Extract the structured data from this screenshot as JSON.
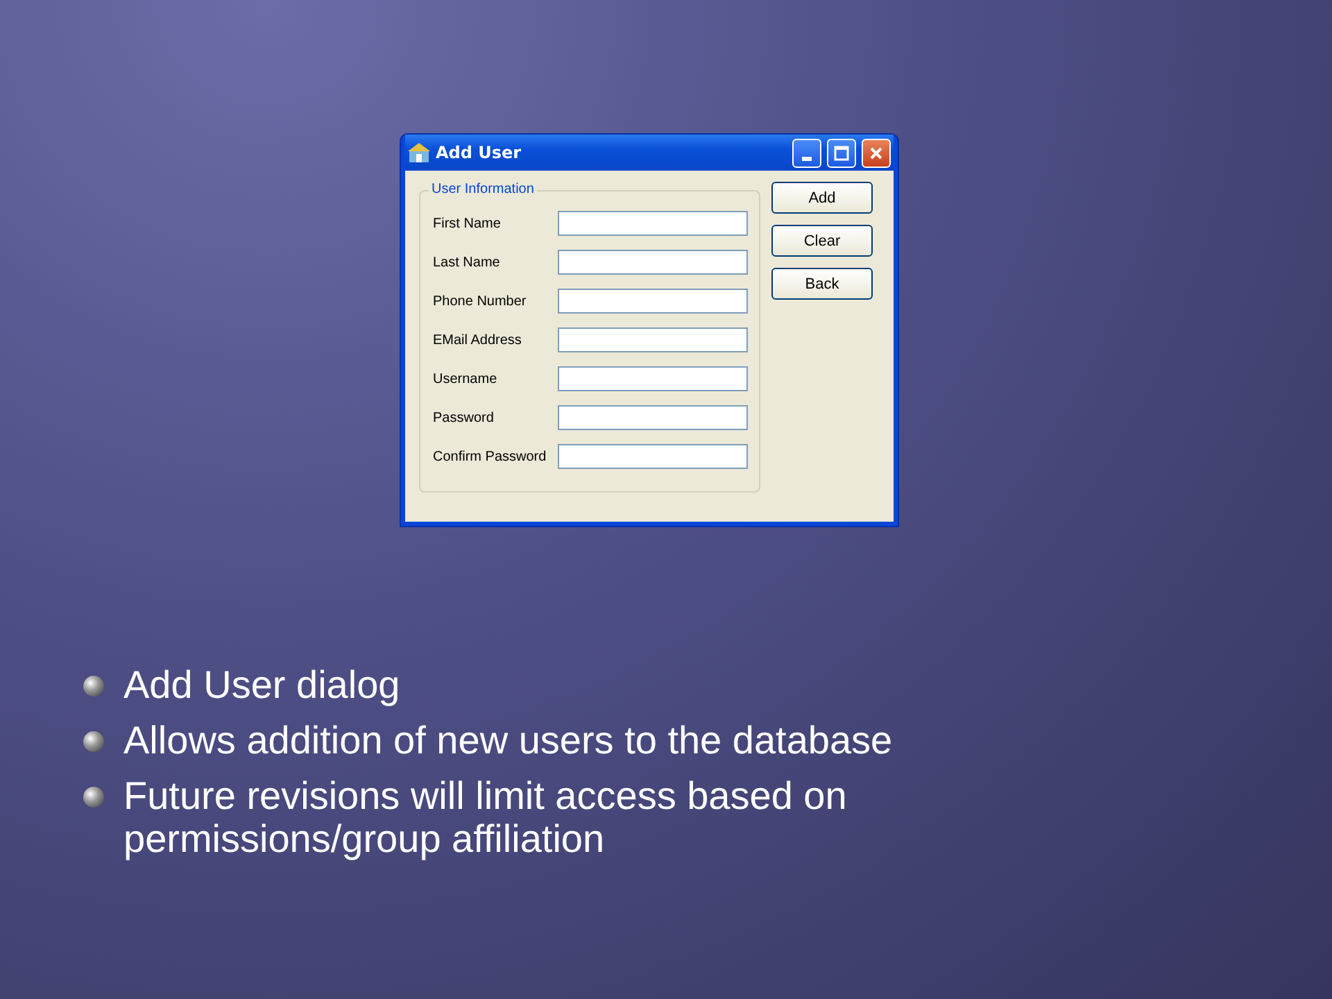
{
  "window": {
    "title": "Add User"
  },
  "group": {
    "legend": "User Information"
  },
  "fields": [
    {
      "label": "First Name"
    },
    {
      "label": "Last Name"
    },
    {
      "label": "Phone Number"
    },
    {
      "label": "EMail Address"
    },
    {
      "label": "Username"
    },
    {
      "label": "Password"
    },
    {
      "label": "Confirm Password"
    }
  ],
  "buttons": [
    "Add",
    "Clear",
    "Back"
  ],
  "bullets": [
    "Add User dialog",
    "Allows addition of new users to the database",
    "Future revisions will limit access based on permissions/group affiliation"
  ]
}
